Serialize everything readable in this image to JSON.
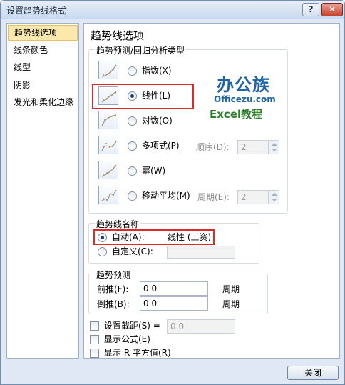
{
  "window": {
    "title": "设置趋势线格式",
    "help_label": "?",
    "close_label": "✕"
  },
  "sidebar": {
    "items": [
      {
        "label": "趋势线选项",
        "selected": true
      },
      {
        "label": "线条颜色",
        "selected": false
      },
      {
        "label": "线型",
        "selected": false
      },
      {
        "label": "阴影",
        "selected": false
      },
      {
        "label": "发光和柔化边缘",
        "selected": false
      }
    ]
  },
  "main": {
    "heading": "趋势线选项",
    "type_group": {
      "label": "趋势预测/回归分析类型",
      "types": [
        {
          "label": "指数(X)",
          "icon": "exponential-trend-icon",
          "selected": false
        },
        {
          "label": "线性(L)",
          "icon": "linear-trend-icon",
          "selected": true
        },
        {
          "label": "对数(O)",
          "icon": "logarithmic-trend-icon",
          "selected": false
        },
        {
          "label": "多项式(P)",
          "icon": "polynomial-trend-icon",
          "selected": false
        },
        {
          "label": "幂(W)",
          "icon": "power-trend-icon",
          "selected": false
        },
        {
          "label": "移动平均(M)",
          "icon": "moving-average-trend-icon",
          "selected": false
        }
      ],
      "order_label": "顺序(D):",
      "order_value": "2",
      "period_label": "周期(E):",
      "period_value": "2"
    },
    "name_group": {
      "label": "趋势线名称",
      "auto_label": "自动(A):",
      "auto_value": "线性 (工资)",
      "custom_label": "自定义(C):",
      "custom_value": ""
    },
    "forecast_group": {
      "label": "趋势预测",
      "forward_label": "前推(F):",
      "forward_value": "0.0",
      "forward_unit": "周期",
      "backward_label": "倒推(B):",
      "backward_value": "0.0",
      "backward_unit": "周期"
    },
    "options": {
      "intercept_label": "设置截距(S) =",
      "intercept_value": "0.0",
      "display_equation_label": "显示公式(E)",
      "display_r2_label": "显示 R 平方值(R)"
    }
  },
  "watermark": {
    "line1": "办公族",
    "line2": "Officezu.com",
    "line3": "Excel教程"
  },
  "footer": {
    "close_label": "关闭"
  },
  "colors": {
    "highlight": "#e02a2a",
    "selection": "#fbe8ad",
    "logo_blue": "#1f63a8",
    "logo_green": "#2f7d2e"
  }
}
